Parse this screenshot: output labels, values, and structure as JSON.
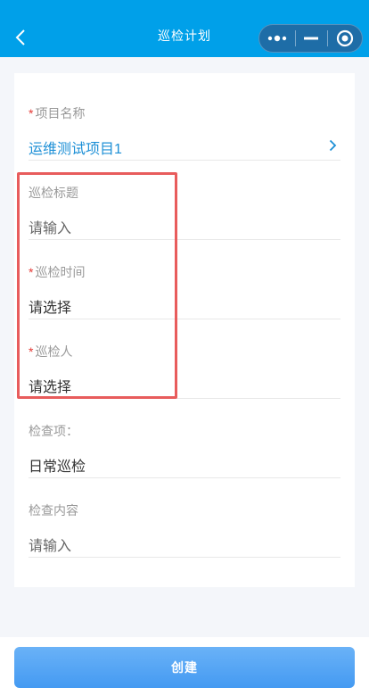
{
  "navbar": {
    "title": "巡检计划",
    "back_icon": "chevron-left-icon",
    "capsule": {
      "more_icon": "more-dots-icon",
      "minimize_icon": "minus-icon",
      "close_icon": "target-circle-icon"
    }
  },
  "form": {
    "project": {
      "required_mark": "*",
      "label": "项目名称",
      "value": "运维测试项目1",
      "chevron_icon": "chevron-right-icon"
    },
    "title": {
      "label": "巡检标题",
      "placeholder": "请输入"
    },
    "time": {
      "required_mark": "*",
      "label": "巡检时间",
      "placeholder": "请选择"
    },
    "inspector": {
      "required_mark": "*",
      "label": "巡检人",
      "placeholder": "请选择"
    },
    "check_item": {
      "label": "检查项：",
      "value": "日常巡检"
    },
    "content": {
      "label": "检查内容",
      "placeholder": "请输入"
    }
  },
  "colors": {
    "navbar": "#00a0e9",
    "link": "#1c8fd6",
    "required": "#e53935",
    "highlight": "#e85c5c",
    "button": "#5aa8f5"
  },
  "actions": {
    "create_label": "创建"
  }
}
